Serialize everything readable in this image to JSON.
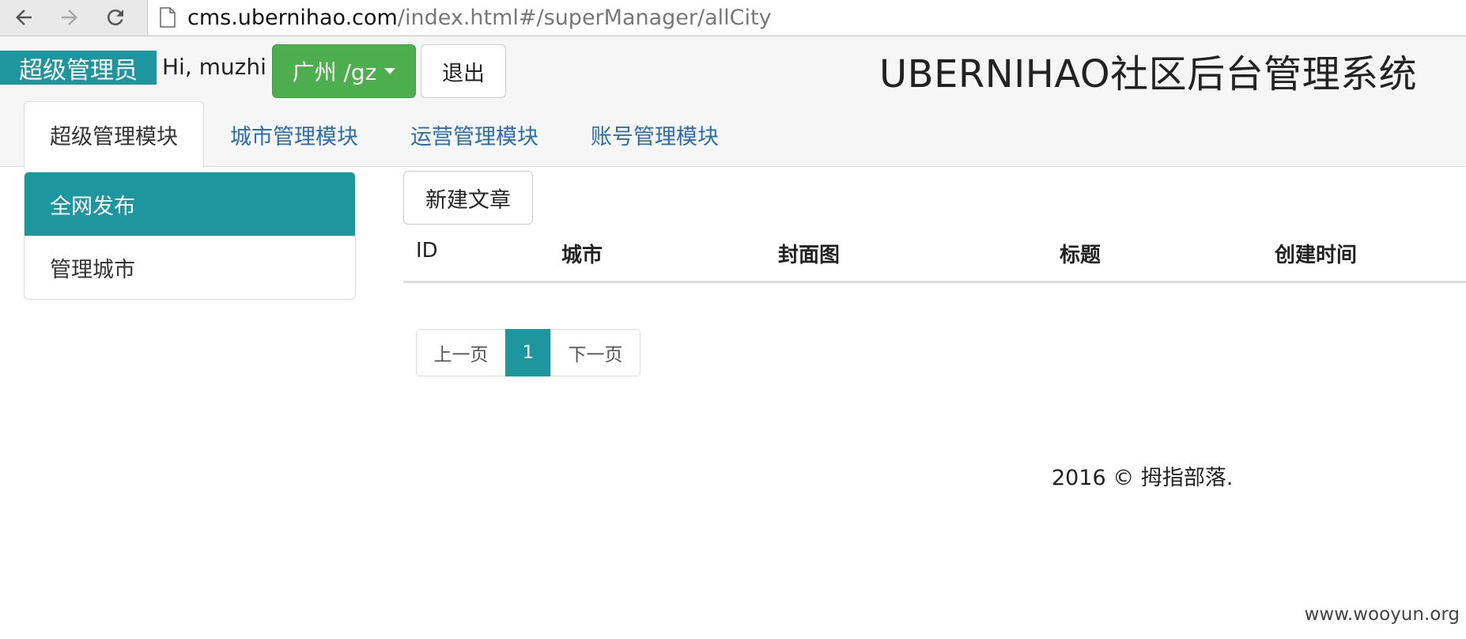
{
  "browser": {
    "url_host": "cms.ubernihao.com",
    "url_path": "/index.html#/superManager/allCity"
  },
  "header": {
    "role_badge": "超级管理员",
    "greeting": "Hi, muzhi !",
    "city_dropdown": "广州 /gz",
    "logout_label": "退出",
    "system_title": "UBERNIHAO社区后台管理系统"
  },
  "tabs": [
    {
      "label": "超级管理模块",
      "active": true
    },
    {
      "label": "城市管理模块",
      "active": false
    },
    {
      "label": "运营管理模块",
      "active": false
    },
    {
      "label": "账号管理模块",
      "active": false
    }
  ],
  "sidebar": {
    "items": [
      {
        "label": "全网发布",
        "active": true
      },
      {
        "label": "管理城市",
        "active": false
      }
    ]
  },
  "main": {
    "new_article_label": "新建文章",
    "table": {
      "columns": [
        "ID",
        "城市",
        "封面图",
        "标题",
        "创建时间"
      ],
      "rows": []
    },
    "pagination": {
      "prev_label": "上一页",
      "current_page": "1",
      "next_label": "下一页"
    }
  },
  "footer": {
    "copyright": "2016 © 拇指部落."
  },
  "watermark": "www.wooyun.org",
  "colors": {
    "accent": "#1e96a0",
    "success": "#4cae4c",
    "link": "#2a6ead"
  }
}
